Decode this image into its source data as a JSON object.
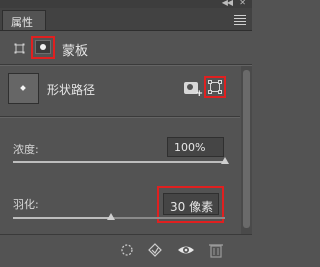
{
  "panel": {
    "tab_label": "属性"
  },
  "header": {
    "label": "蒙板"
  },
  "mask_row": {
    "label": "形状路径"
  },
  "density": {
    "label": "浓度:",
    "value": "100%",
    "level_percent": 100
  },
  "feather": {
    "label": "羽化:",
    "value": "30 像素",
    "level_fraction": 0.46
  },
  "icons": [
    "pixel-mask-icon",
    "vector-mask-icon",
    "add-pixel-mask-icon",
    "add-vector-mask-icon",
    "selection-from-mask-icon",
    "apply-mask-icon",
    "visibility-icon",
    "delete-icon"
  ],
  "colors": {
    "panel_bg": "#535353",
    "highlight": "#e02020"
  }
}
